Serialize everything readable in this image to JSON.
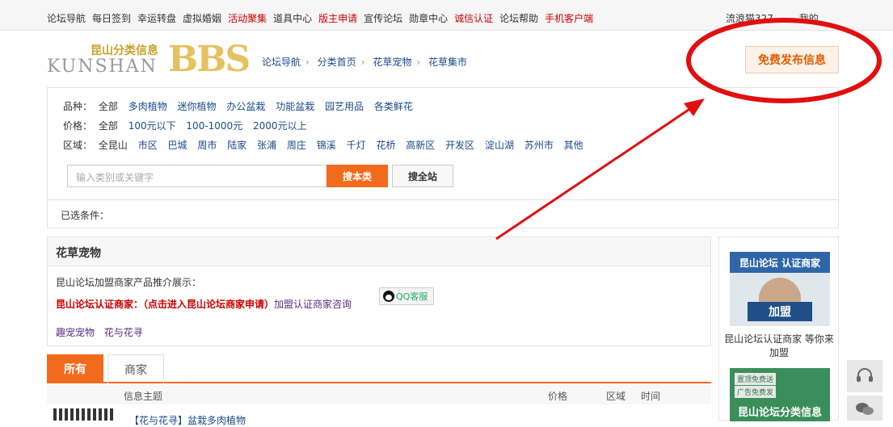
{
  "topnav": {
    "items": [
      "论坛导航",
      "每日签到",
      "幸运转盘",
      "虚拟婚姻",
      "活动聚集",
      "道具中心",
      "版主申请",
      "宣传论坛",
      "勋章中心",
      "诚信认证",
      "论坛帮助",
      "手机客户端"
    ],
    "right": [
      "流浪猫327",
      "我的"
    ]
  },
  "logo": {
    "cn": "昆山分类信息",
    "en": "KUNSHAN",
    "bbs": "BBS"
  },
  "breadcrumb": [
    "论坛导航",
    "分类首页",
    "花草宠物",
    "花草集市"
  ],
  "post_button": "免费发布信息",
  "filters": {
    "variety": {
      "label": "品种：",
      "options": [
        "全部",
        "多肉植物",
        "迷你植物",
        "办公盆栽",
        "功能盆栽",
        "园艺用品",
        "各类鲜花"
      ]
    },
    "price": {
      "label": "价格：",
      "options": [
        "全部",
        "100元以下",
        "100-1000元",
        "2000元以上"
      ]
    },
    "region": {
      "label": "区域：",
      "options": [
        "全昆山",
        "市区",
        "巴城",
        "周市",
        "陆家",
        "张浦",
        "周庄",
        "锦溪",
        "千灯",
        "花桥",
        "高新区",
        "开发区",
        "淀山湖",
        "苏州市",
        "其他"
      ]
    }
  },
  "search": {
    "placeholder": "输入类别或关键字",
    "local": "搜本类",
    "all": "搜全站"
  },
  "selected_label": "已选条件：",
  "category": {
    "title": "花草宠物",
    "intro": "昆山论坛加盟商家产品推介展示：",
    "merchant_label": "昆山论坛认证商家：（点击进入昆山论坛商家申请）",
    "join_link": "加盟认证商家咨询",
    "qq": "QQ客服",
    "links": [
      "趣宠宠物",
      "花与花寻"
    ]
  },
  "tabs": [
    "所有",
    "商家"
  ],
  "table_headers": {
    "subject": "信息主题",
    "price": "价格",
    "region": "区域",
    "time": "时间"
  },
  "first_row_title": "【花与花寻】盆栽多肉植物",
  "sidebar": {
    "ad1_title": "昆山论坛 认证商家",
    "ad1_join": "加盟",
    "caption": "昆山论坛认证商家 等你来加盟",
    "ad2_tag1": "置顶免费送",
    "ad2_tag2": "广告免费发",
    "ad2_title": "昆山论坛分类信息"
  },
  "colors": {
    "accent": "#f26b1d",
    "link": "#1a4a8a",
    "red": "#cc0000",
    "annotation": "#e01010"
  }
}
